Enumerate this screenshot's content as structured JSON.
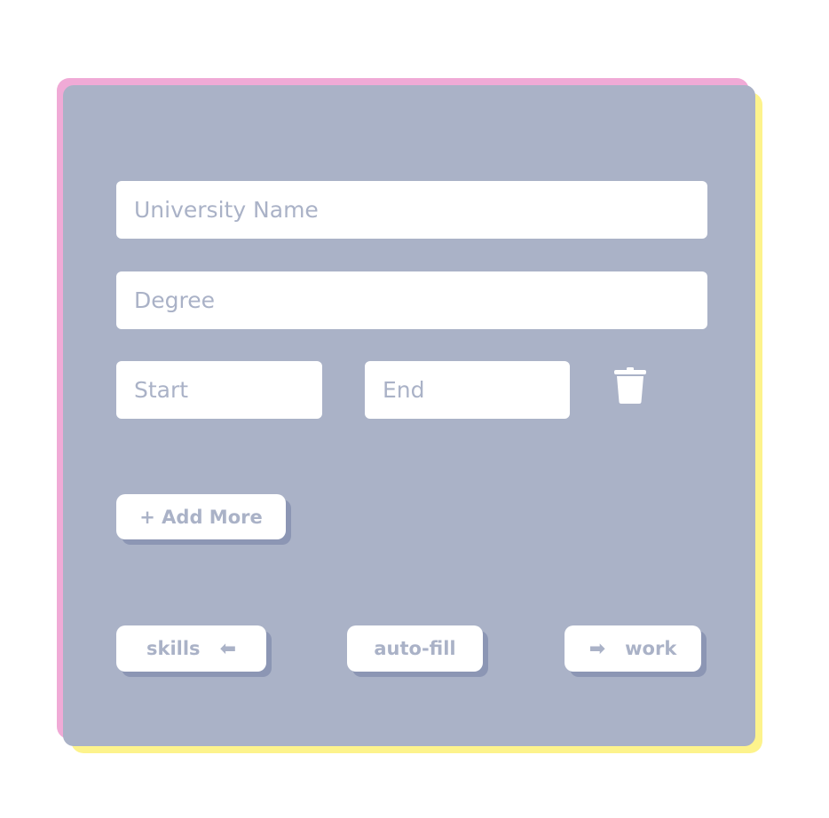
{
  "form": {
    "university": {
      "placeholder": "University Name",
      "value": ""
    },
    "degree": {
      "placeholder": "Degree",
      "value": ""
    },
    "start": {
      "placeholder": "Start",
      "value": ""
    },
    "end": {
      "placeholder": "End",
      "value": ""
    }
  },
  "actions": {
    "add_more_label": "+ Add More",
    "skills_label": "skills",
    "skills_arrow": "⬅",
    "autofill_label": "auto-fill",
    "work_arrow": "➡",
    "work_label": "work"
  },
  "icons": {
    "delete": "trash-icon",
    "back": "left-arrow-icon",
    "next": "right-arrow-icon"
  },
  "colors": {
    "card_background": "#aab2c7",
    "accent_pink": "#f0aad6",
    "accent_yellow": "#fdf38c",
    "button_shadow": "#8c96b4",
    "text_muted": "#aab2c7",
    "surface": "#ffffff"
  }
}
